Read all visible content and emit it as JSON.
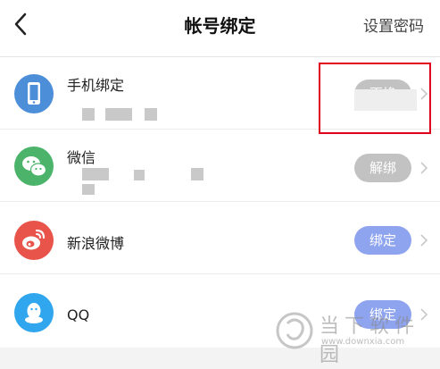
{
  "nav": {
    "title": "帐号绑定",
    "action": "设置密码",
    "back_icon": "chevron-left-icon"
  },
  "accounts": [
    {
      "label": "手机绑定",
      "button": "更换",
      "button_style": "gray",
      "icon": "phone-icon",
      "color": "#4d8ed9"
    },
    {
      "label": "微信",
      "button": "解绑",
      "button_style": "gray",
      "icon": "wechat-icon",
      "color": "#4cb36b"
    },
    {
      "label": "新浪微博",
      "button": "绑定",
      "button_style": "blue",
      "icon": "weibo-icon",
      "color": "#e9544a"
    },
    {
      "label": "QQ",
      "button": "绑定",
      "button_style": "blue",
      "icon": "qq-icon",
      "color": "#2fa6ee"
    }
  ],
  "watermark": {
    "title": "当下软件园",
    "url": "www.downxia.com"
  },
  "colors": {
    "highlight": "#e0001b",
    "button_gray": "#c2c2c2",
    "button_blue": "#8fa4ef"
  }
}
